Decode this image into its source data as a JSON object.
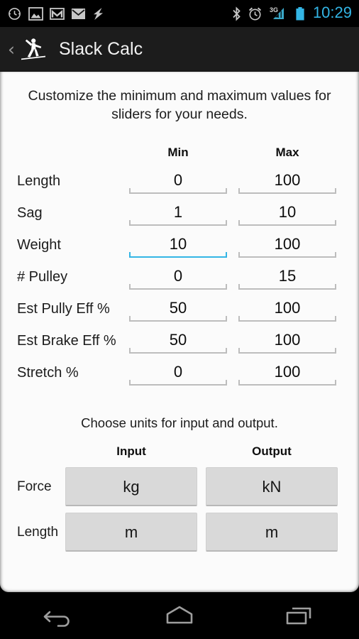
{
  "statusbar": {
    "time": "10:29",
    "left_icons": [
      "clock-badge-icon",
      "photo-icon",
      "gmail-icon",
      "mail-icon",
      "lightning-icon"
    ],
    "right_icons": [
      "bluetooth-icon",
      "alarm-icon",
      "signal-3g-icon",
      "battery-icon"
    ],
    "network_label": "3G",
    "accent_color": "#33b5e5"
  },
  "actionbar": {
    "back_label": "‹",
    "app_icon": "slackliner-icon",
    "title": "Slack Calc"
  },
  "main": {
    "intro": "Customize the minimum and maximum values for sliders for your needs.",
    "sliders": {
      "headers": [
        "Min",
        "Max"
      ],
      "rows": [
        {
          "label": "Length",
          "min": "0",
          "max": "100",
          "focused": "none"
        },
        {
          "label": "Sag",
          "min": "1",
          "max": "10",
          "focused": "none"
        },
        {
          "label": "Weight",
          "min": "10",
          "max": "100",
          "focused": "min"
        },
        {
          "label": "# Pulley",
          "min": "0",
          "max": "15",
          "focused": "none"
        },
        {
          "label": "Est Pully Eff %",
          "min": "50",
          "max": "100",
          "focused": "none"
        },
        {
          "label": "Est Brake Eff %",
          "min": "50",
          "max": "100",
          "focused": "none"
        },
        {
          "label": "Stretch %",
          "min": "0",
          "max": "100",
          "focused": "none"
        }
      ]
    },
    "units": {
      "intro": "Choose units for input and output.",
      "headers": [
        "Input",
        "Output"
      ],
      "rows": [
        {
          "label": "Force",
          "input": "kg",
          "output": "kN"
        },
        {
          "label": "Length",
          "input": "m",
          "output": "m"
        }
      ]
    },
    "focus_color": "#33b5e5"
  },
  "navbar": {
    "buttons": [
      "back-nav-icon",
      "home-nav-icon",
      "recents-nav-icon"
    ]
  }
}
